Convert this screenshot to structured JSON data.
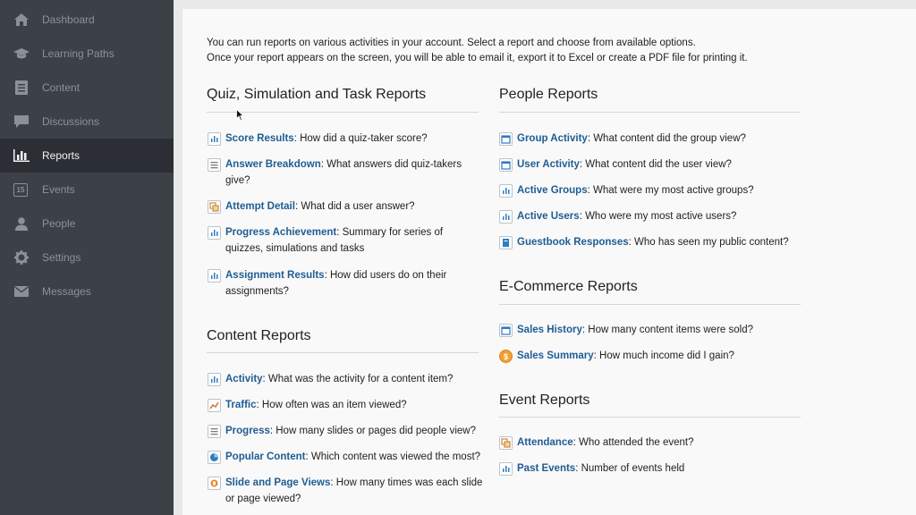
{
  "sidebar": {
    "items": [
      {
        "label": "Dashboard",
        "icon": "home-icon"
      },
      {
        "label": "Learning Paths",
        "icon": "graduation-cap-icon"
      },
      {
        "label": "Content",
        "icon": "document-icon"
      },
      {
        "label": "Discussions",
        "icon": "chat-icon"
      },
      {
        "label": "Reports",
        "icon": "bar-chart-icon"
      },
      {
        "label": "Events",
        "icon": "calendar-icon"
      },
      {
        "label": "People",
        "icon": "person-icon"
      },
      {
        "label": "Settings",
        "icon": "gear-icon"
      },
      {
        "label": "Messages",
        "icon": "envelope-icon"
      }
    ],
    "calendar_day": "15"
  },
  "intro": {
    "line1": "You can run reports on various activities in your account. Select a report and choose from available options.",
    "line2": "Once your report appears on the screen, you will be able to email it, export it to Excel or create a PDF file for printing it."
  },
  "sections": {
    "quiz": {
      "title": "Quiz, Simulation and Task Reports",
      "items": [
        {
          "link": "Score Results",
          "desc": ": How did a quiz-taker score?"
        },
        {
          "link": "Answer Breakdown",
          "desc": ": What answers did quiz-takers give?"
        },
        {
          "link": "Attempt Detail",
          "desc": ": What did a user answer?"
        },
        {
          "link": "Progress Achievement",
          "desc": ": Summary for series of quizzes, simulations and tasks"
        },
        {
          "link": "Assignment Results",
          "desc": ": How did users do on their assignments?"
        }
      ]
    },
    "content": {
      "title": "Content Reports",
      "items": [
        {
          "link": "Activity",
          "desc": ": What was the activity for a content item?"
        },
        {
          "link": "Traffic",
          "desc": ": How often was an item viewed?"
        },
        {
          "link": "Progress",
          "desc": ": How many slides or pages did people view?"
        },
        {
          "link": "Popular Content",
          "desc": ": Which content was viewed the most?"
        },
        {
          "link": "Slide and Page Views",
          "desc": ": How many times was each slide or page viewed?"
        }
      ]
    },
    "people": {
      "title": "People Reports",
      "items": [
        {
          "link": "Group Activity",
          "desc": ": What content did the group view?"
        },
        {
          "link": "User Activity",
          "desc": ": What content did the user view?"
        },
        {
          "link": "Active Groups",
          "desc": ": What were my most active groups?"
        },
        {
          "link": "Active Users",
          "desc": ": Who were my most active users?"
        },
        {
          "link": "Guestbook Responses",
          "desc": ": Who has seen my public content?"
        }
      ]
    },
    "ecommerce": {
      "title": "E-Commerce Reports",
      "items": [
        {
          "link": "Sales History",
          "desc": ": How many content items were sold?"
        },
        {
          "link": "Sales Summary",
          "desc": ": How much income did I gain?"
        }
      ]
    },
    "event": {
      "title": "Event Reports",
      "items": [
        {
          "link": "Attendance",
          "desc": ": Who attended the event?"
        },
        {
          "link": "Past Events",
          "desc": ": Number of events held"
        }
      ]
    }
  },
  "colors": {
    "sidebar_bg": "#3c4148",
    "sidebar_active_bg": "#2b2f35",
    "link": "#1f5d93",
    "page_bg": "#f9f9f9"
  }
}
